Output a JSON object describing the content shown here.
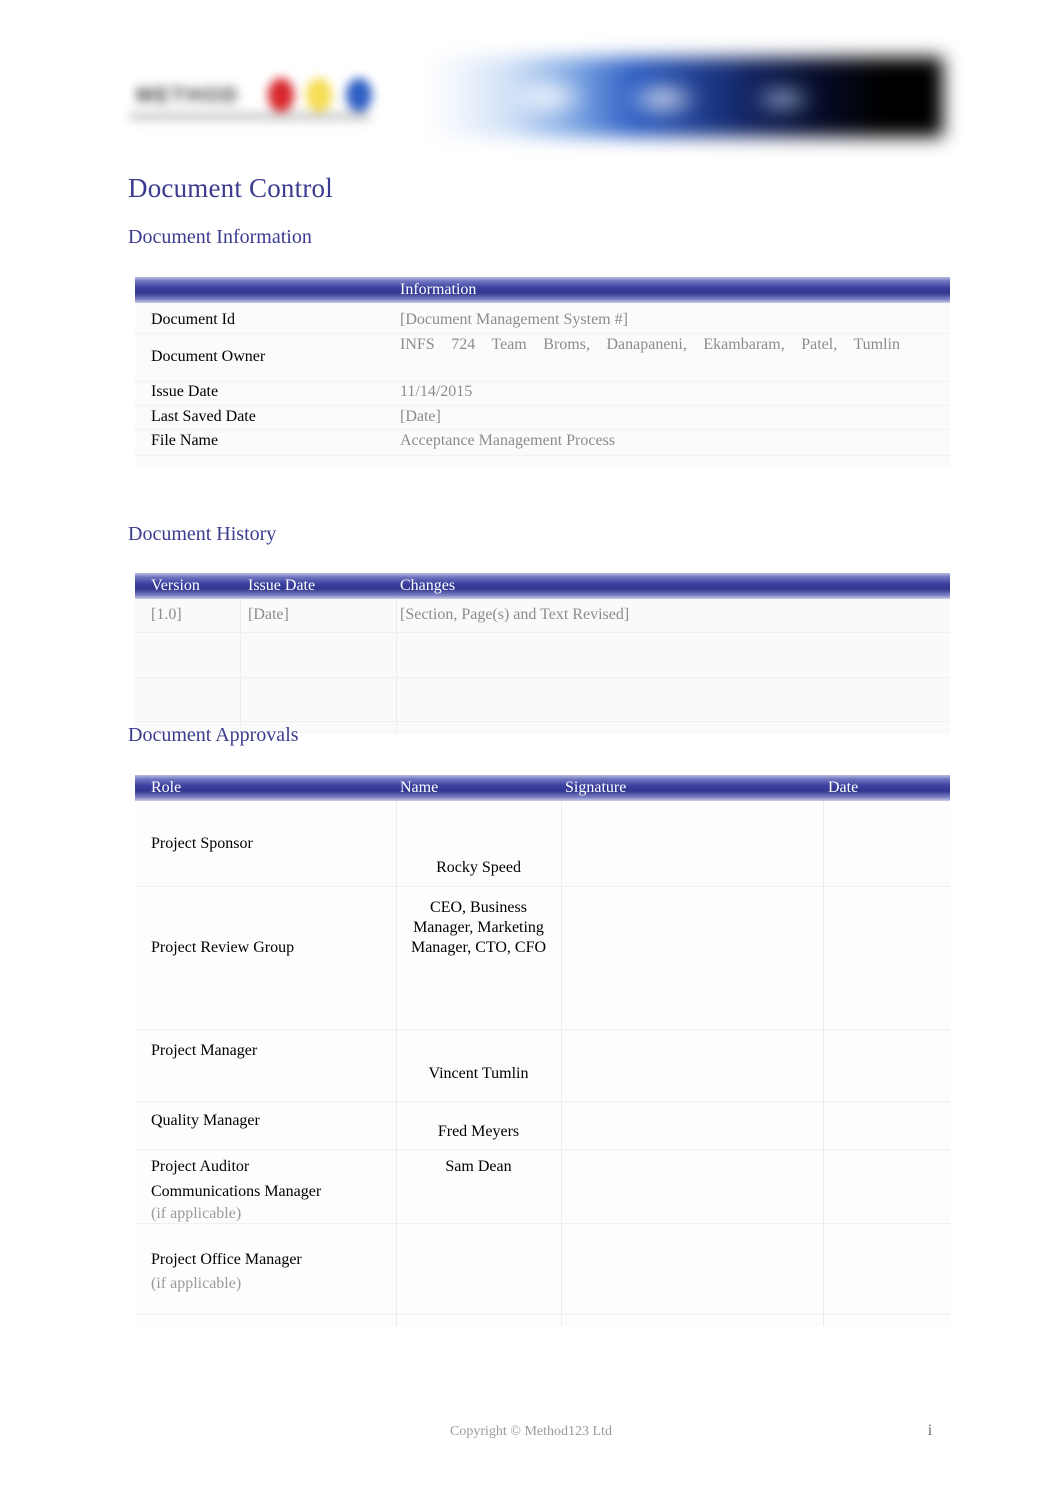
{
  "header": {
    "left_logo_text": "METHOD",
    "left_logo_name": "method123-logo",
    "right_banner_name": "project-banner-image"
  },
  "title": "Document Control",
  "sections": {
    "information": {
      "heading": "Document Information",
      "column_header": "Information",
      "rows": [
        {
          "label": "Document Id",
          "value": "[Document Management System #]"
        },
        {
          "label": "Document Owner",
          "value": "INFS 724 Team Broms, Danapaneni, Ekambaram, Patel, Tumlin"
        },
        {
          "label": "Issue Date",
          "value": "11/14/2015"
        },
        {
          "label": "Last Saved Date",
          "value": "[Date]"
        },
        {
          "label": "File Name",
          "value": "Acceptance Management Process"
        }
      ]
    },
    "history": {
      "heading": "Document History",
      "columns": [
        "Version",
        "Issue Date",
        "Changes"
      ],
      "rows": [
        {
          "version": "[1.0]",
          "issue_date": "[Date]",
          "changes": "[Section, Page(s) and Text Revised]"
        },
        {
          "version": "",
          "issue_date": "",
          "changes": ""
        },
        {
          "version": "",
          "issue_date": "",
          "changes": ""
        }
      ]
    },
    "approvals": {
      "heading": "Document Approvals",
      "columns": [
        "Role",
        "Name",
        "Signature",
        "Date"
      ],
      "rows": [
        {
          "role": "Project Sponsor",
          "role_note": "",
          "name": "Rocky Speed",
          "signature": "",
          "date": ""
        },
        {
          "role": "Project Review Group",
          "role_note": "",
          "name": "CEO, Business Manager, Marketing Manager, CTO, CFO",
          "signature": "",
          "date": ""
        },
        {
          "role": "Project Manager",
          "role_note": "",
          "name": "Vincent Tumlin",
          "signature": "",
          "date": ""
        },
        {
          "role": "Quality Manager",
          "role_note": "",
          "name": "Fred Meyers",
          "signature": "",
          "date": ""
        },
        {
          "role": "Project Auditor",
          "role_note": "",
          "name": "Sam Dean",
          "signature": "",
          "date": ""
        },
        {
          "role": "Communications Manager",
          "role_note": "(if applicable)",
          "name": "",
          "signature": "",
          "date": ""
        },
        {
          "role": "Project Office Manager",
          "role_note": "(if applicable)",
          "name": "",
          "signature": "",
          "date": ""
        }
      ]
    }
  },
  "footer": {
    "copyright": "Copyright © Method123 Ltd",
    "page_number": "i"
  },
  "colors": {
    "heading_blue": "#3b3b8f",
    "table_header_blue": "#33378f",
    "placeholder_gray": "#8c8c8c"
  }
}
